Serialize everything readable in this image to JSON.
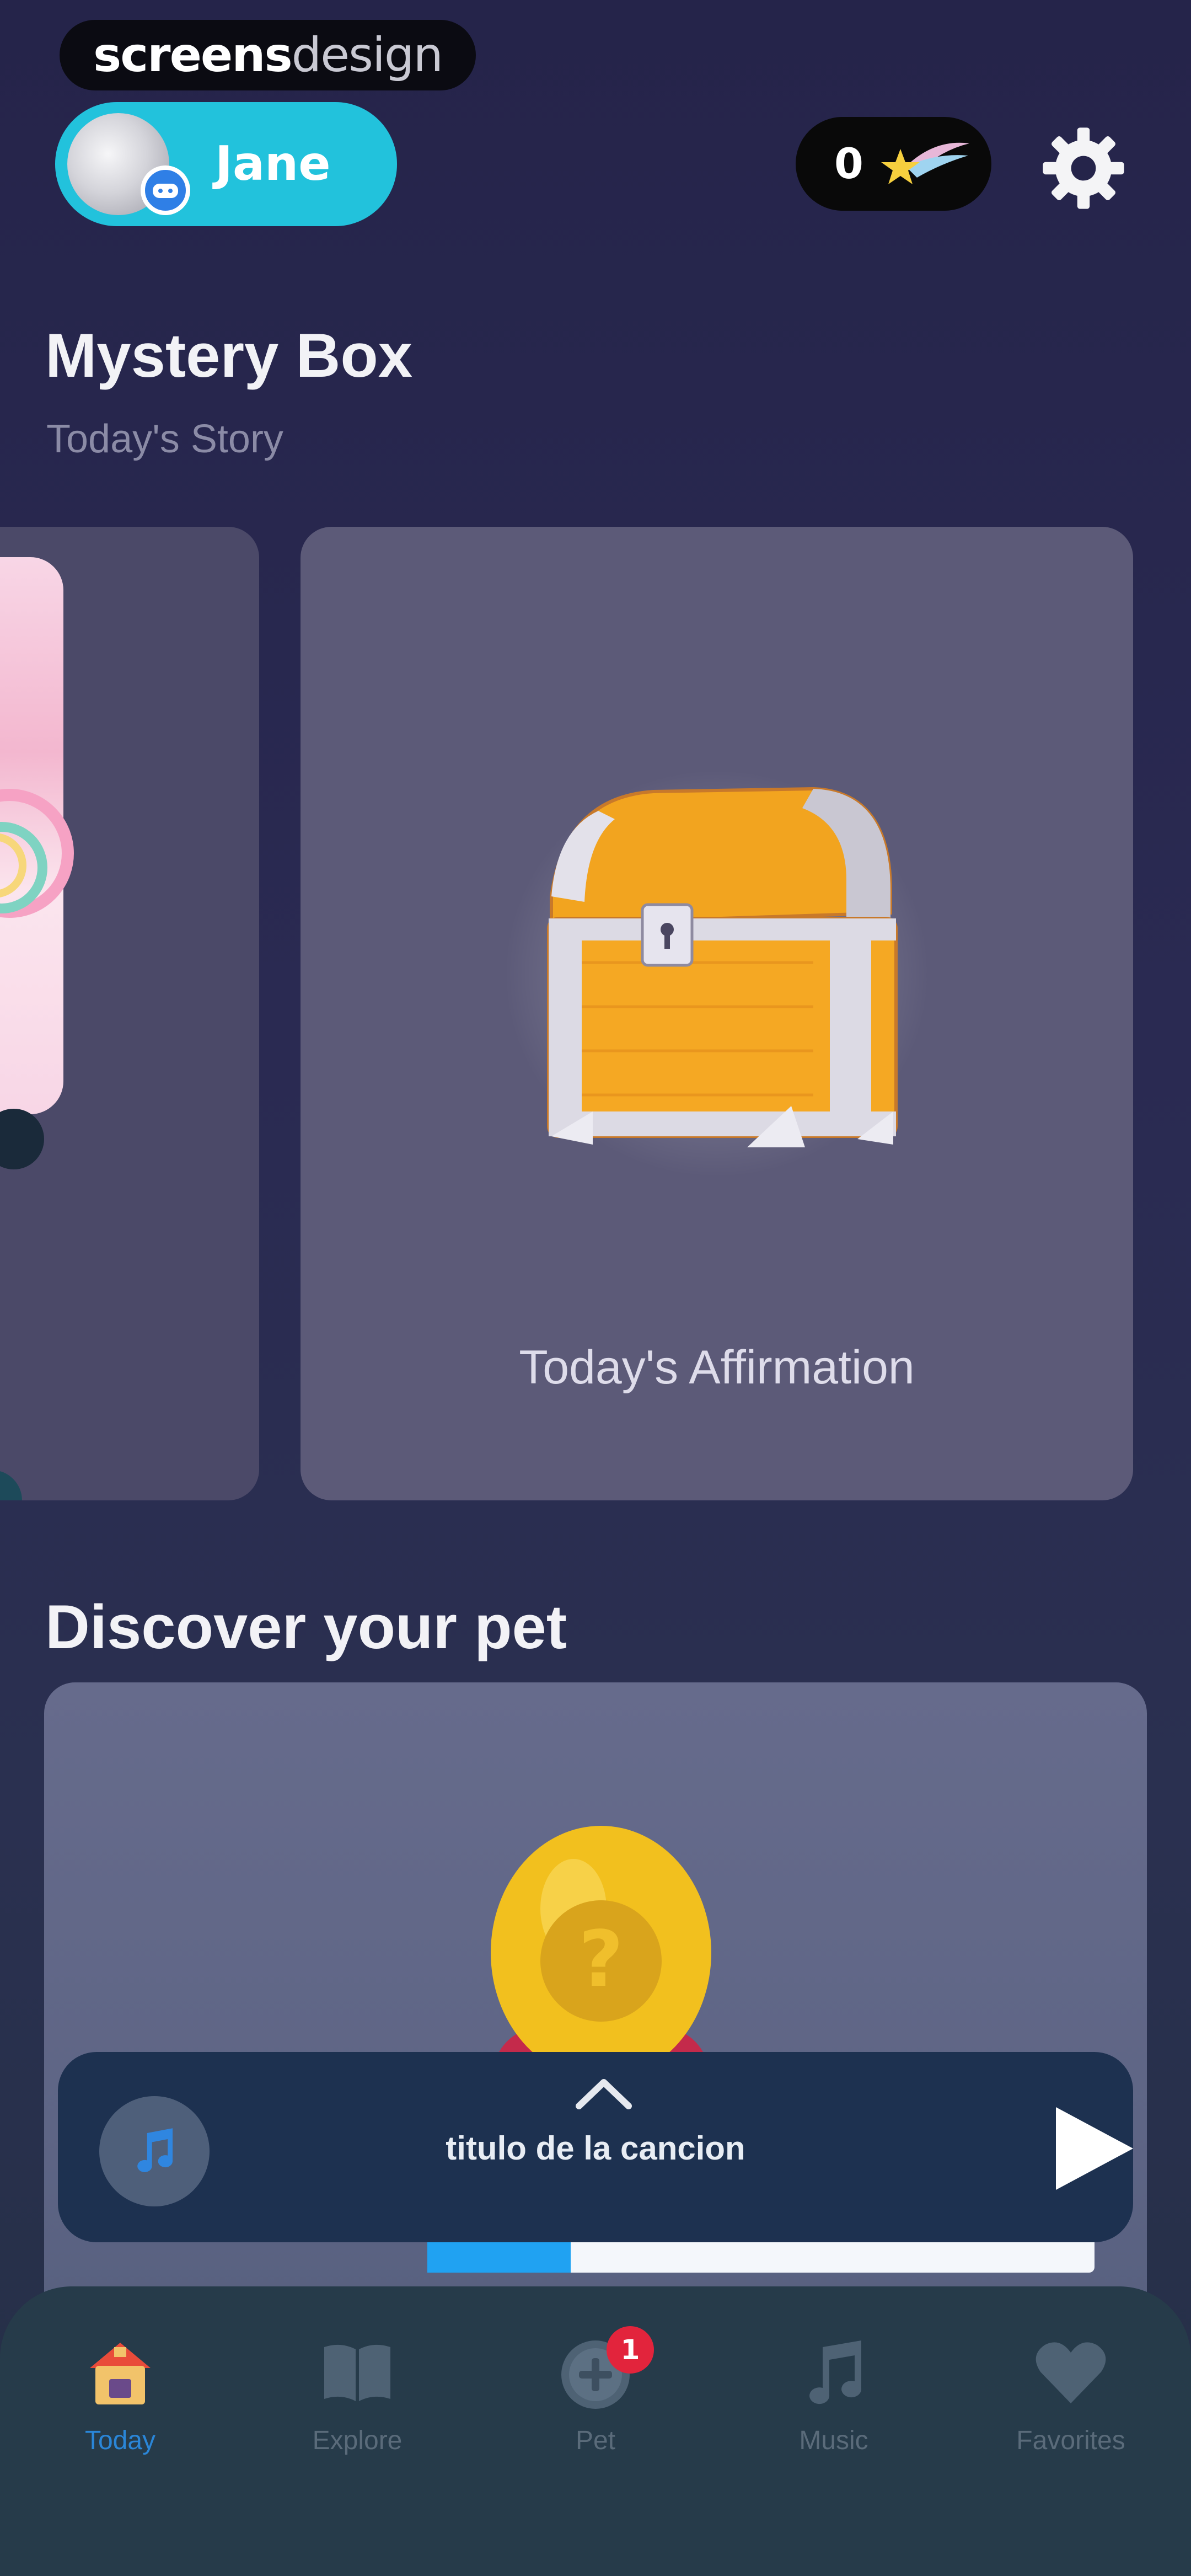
{
  "watermark": {
    "bold": "screens",
    "light": "design"
  },
  "profile": {
    "name": "Jane"
  },
  "coins": {
    "count": "0"
  },
  "mystery": {
    "title": "Mystery Box",
    "subtitle": "Today's Story",
    "main_card_caption": "Today's Affirmation"
  },
  "pet": {
    "title": "Discover your pet"
  },
  "player": {
    "title": "titulo de la cancion"
  },
  "tabs": [
    {
      "label": "Today",
      "icon": "home-icon",
      "active": true
    },
    {
      "label": "Explore",
      "icon": "book-icon"
    },
    {
      "label": "Pet",
      "icon": "pet-icon",
      "badge": "1"
    },
    {
      "label": "Music",
      "icon": "music-note-icon"
    },
    {
      "label": "Favorites",
      "icon": "heart-icon"
    }
  ],
  "colors": {
    "background": "#25244a",
    "accent_cyan": "#22c2dc",
    "card": "#5c5a78",
    "player": "#1d3150",
    "tabbar": "#263b4a",
    "active_tab": "#2a86d8",
    "badge": "#e2243c"
  }
}
